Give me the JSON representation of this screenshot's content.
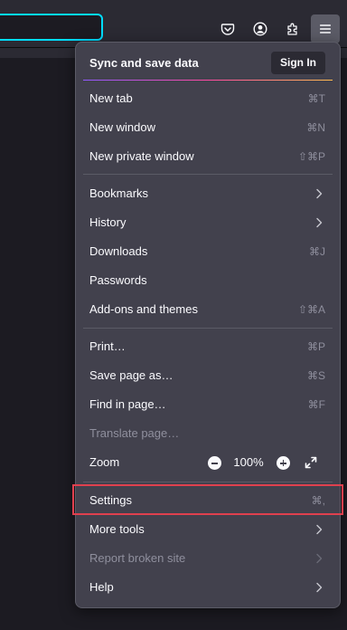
{
  "toolbar": {
    "buttons": [
      {
        "icon": "pocket-icon"
      },
      {
        "icon": "account-icon"
      },
      {
        "icon": "extensions-icon"
      },
      {
        "icon": "menu-icon",
        "active": true
      }
    ]
  },
  "menu": {
    "header": {
      "title": "Sync and save data",
      "sign_in_label": "Sign In"
    },
    "items": {
      "new_tab": {
        "label": "New tab",
        "shortcut": "⌘T"
      },
      "new_window": {
        "label": "New window",
        "shortcut": "⌘N"
      },
      "new_private_window": {
        "label": "New private window",
        "shortcut": "⇧⌘P"
      },
      "bookmarks": {
        "label": "Bookmarks"
      },
      "history": {
        "label": "History"
      },
      "downloads": {
        "label": "Downloads",
        "shortcut": "⌘J"
      },
      "passwords": {
        "label": "Passwords"
      },
      "addons": {
        "label": "Add-ons and themes",
        "shortcut": "⇧⌘A"
      },
      "print": {
        "label": "Print…",
        "shortcut": "⌘P"
      },
      "save_page": {
        "label": "Save page as…",
        "shortcut": "⌘S"
      },
      "find": {
        "label": "Find in page…",
        "shortcut": "⌘F"
      },
      "translate": {
        "label": "Translate page…",
        "disabled": true
      },
      "zoom": {
        "label": "Zoom",
        "value": "100%"
      },
      "settings": {
        "label": "Settings",
        "shortcut": "⌘,",
        "highlighted": true
      },
      "more_tools": {
        "label": "More tools"
      },
      "report_broken": {
        "label": "Report broken site",
        "disabled": true
      },
      "help": {
        "label": "Help"
      }
    }
  },
  "colors": {
    "menu_bg": "#42414d",
    "toolbar_bg": "#2b2a33",
    "url_focus": "#00ddff",
    "highlight_border": "#e0404e"
  }
}
